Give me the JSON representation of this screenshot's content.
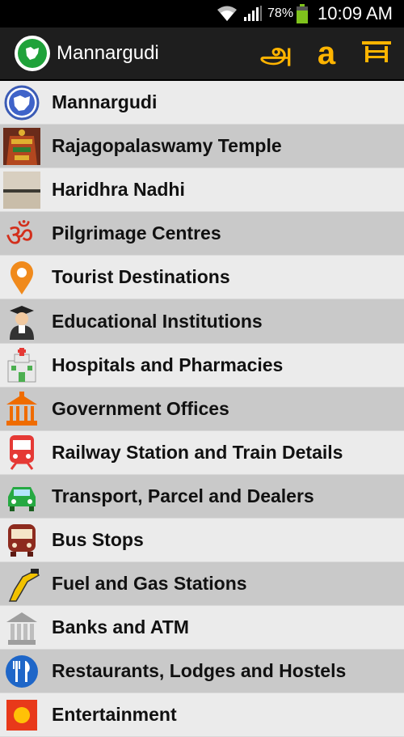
{
  "status": {
    "battery_pct": "78%",
    "time": "10:09 AM"
  },
  "header": {
    "title": "Mannargudi",
    "tamil_lang_glyph": "அ",
    "english_lang_glyph": "a",
    "colors": {
      "accent": "#ffb400",
      "bar": "#1e1e1e"
    }
  },
  "menu": {
    "items": [
      {
        "label": "Mannargudi",
        "icon": "map-logo-icon"
      },
      {
        "label": "Rajagopalaswamy Temple",
        "icon": "temple-photo-icon"
      },
      {
        "label": "Haridhra Nadhi",
        "icon": "river-photo-icon"
      },
      {
        "label": "Pilgrimage Centres",
        "icon": "om-icon"
      },
      {
        "label": "Tourist Destinations",
        "icon": "location-pin-icon"
      },
      {
        "label": "Educational Institutions",
        "icon": "graduate-icon"
      },
      {
        "label": "Hospitals and Pharmacies",
        "icon": "hospital-icon"
      },
      {
        "label": "Government Offices",
        "icon": "government-building-icon"
      },
      {
        "label": "Railway Station and Train Details",
        "icon": "train-icon"
      },
      {
        "label": "Transport, Parcel and Dealers",
        "icon": "car-icon"
      },
      {
        "label": "Bus Stops",
        "icon": "bus-icon"
      },
      {
        "label": "Fuel and Gas Stations",
        "icon": "fuel-nozzle-icon"
      },
      {
        "label": "Banks and ATM",
        "icon": "bank-icon"
      },
      {
        "label": "Restaurants, Lodges and Hostels",
        "icon": "fork-knife-icon"
      },
      {
        "label": "Entertainment",
        "icon": "entertainment-icon"
      }
    ]
  }
}
